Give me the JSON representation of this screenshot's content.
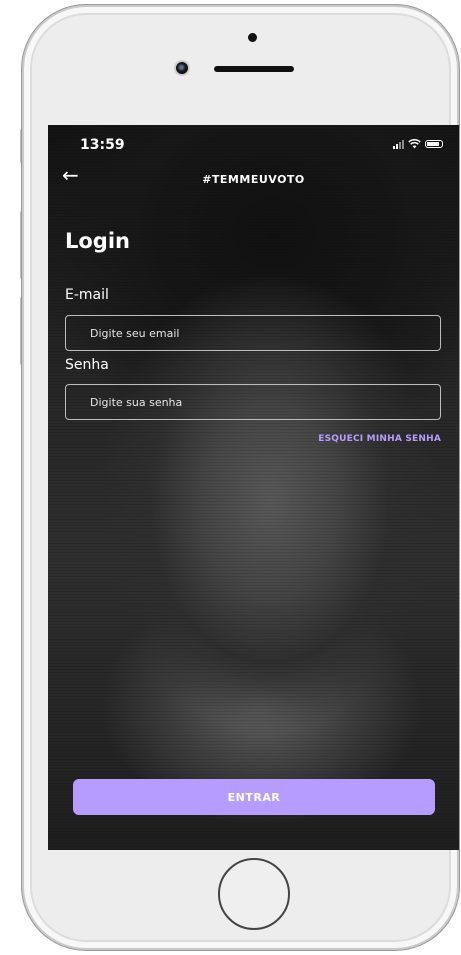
{
  "status_bar": {
    "time": "13:59"
  },
  "header": {
    "back_icon": "arrow-left-icon",
    "title": "#TEMMEUVOTO"
  },
  "login": {
    "heading": "Login",
    "email_label": "E-mail",
    "email_placeholder": "Digite seu email",
    "password_label": "Senha",
    "password_placeholder": "Digite sua senha",
    "forgot_link": "ESQUECI MINHA SENHA",
    "submit_label": "ENTRAR"
  },
  "colors": {
    "accent": "#b79cff",
    "text": "#ffffff"
  }
}
